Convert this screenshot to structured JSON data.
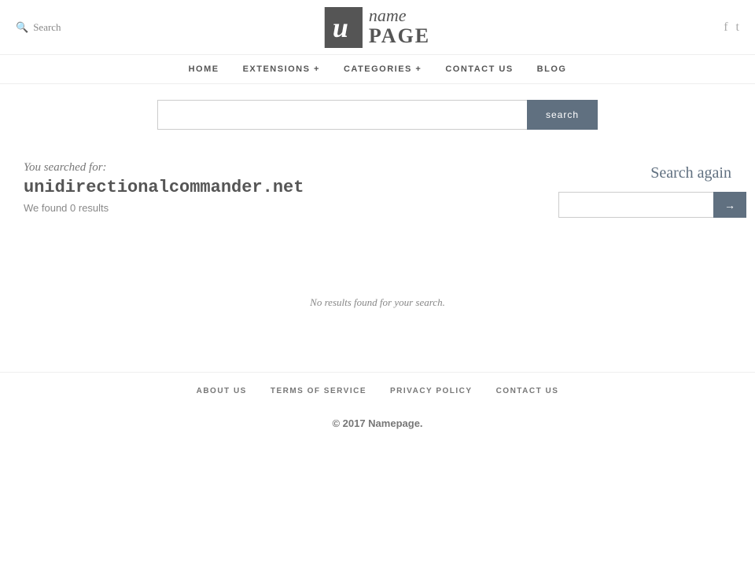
{
  "header": {
    "search_label": "Search",
    "logo_letter": "u",
    "logo_name": "name",
    "logo_page": "PAGE",
    "facebook_icon": "f",
    "twitter_icon": "t"
  },
  "nav": {
    "items": [
      {
        "label": "HOME"
      },
      {
        "label": "EXTENSIONS +"
      },
      {
        "label": "CATEGORIES +"
      },
      {
        "label": "CONTACT  US"
      },
      {
        "label": "BLOG"
      }
    ]
  },
  "search_bar": {
    "placeholder": "",
    "button_label": "search"
  },
  "content": {
    "you_searched_label": "You searched for:",
    "searched_term": "unidirectionalcommander.net",
    "results_count": "We found 0 results",
    "no_results_text": "No results found for your search."
  },
  "search_again": {
    "title": "Search again",
    "placeholder": "",
    "button_label": "→"
  },
  "footer": {
    "nav_items": [
      {
        "label": "ABOUT  US"
      },
      {
        "label": "TERMS  OF  SERVICE"
      },
      {
        "label": "PRIVACY  POLICY"
      },
      {
        "label": "CONTACT  US"
      }
    ],
    "copyright_text": "© 2017 ",
    "brand_name": "Namepage",
    "copyright_end": "."
  }
}
